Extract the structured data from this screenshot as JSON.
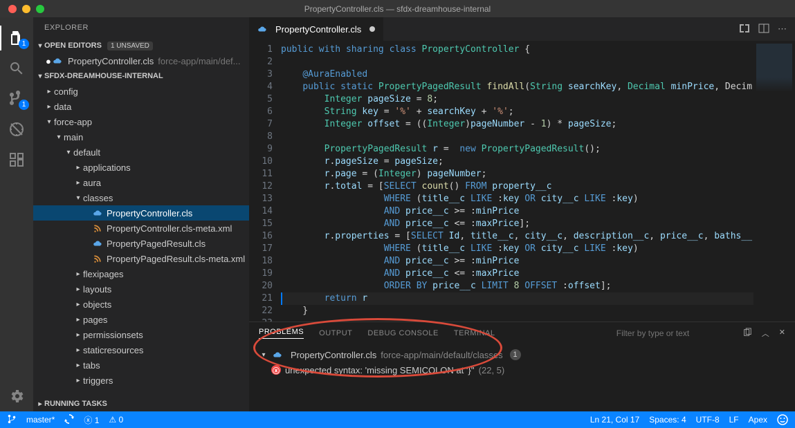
{
  "window": {
    "title": "PropertyController.cls — sfdx-dreamhouse-internal"
  },
  "activity": {
    "badges": {
      "explorer": "1",
      "scm": "1"
    }
  },
  "sidebar": {
    "header": "EXPLORER",
    "openEditors": {
      "title": "OPEN EDITORS",
      "unsaved": "1 UNSAVED"
    },
    "openFile": {
      "name": "PropertyController.cls",
      "path": "force-app/main/def..."
    },
    "projectName": "SFDX-DREAMHOUSE-INTERNAL",
    "tree": [
      {
        "indent": 0,
        "arrow": "▸",
        "label": "config"
      },
      {
        "indent": 0,
        "arrow": "▸",
        "label": "data"
      },
      {
        "indent": 0,
        "arrow": "▾",
        "label": "force-app"
      },
      {
        "indent": 1,
        "arrow": "▾",
        "label": "main"
      },
      {
        "indent": 2,
        "arrow": "▾",
        "label": "default"
      },
      {
        "indent": 3,
        "arrow": "▸",
        "label": "applications"
      },
      {
        "indent": 3,
        "arrow": "▸",
        "label": "aura"
      },
      {
        "indent": 3,
        "arrow": "▾",
        "label": "classes"
      },
      {
        "indent": 4,
        "icon": "cloud",
        "label": "PropertyController.cls",
        "selected": true
      },
      {
        "indent": 4,
        "icon": "feed",
        "label": "PropertyController.cls-meta.xml"
      },
      {
        "indent": 4,
        "icon": "cloud",
        "label": "PropertyPagedResult.cls"
      },
      {
        "indent": 4,
        "icon": "feed",
        "label": "PropertyPagedResult.cls-meta.xml"
      },
      {
        "indent": 3,
        "arrow": "▸",
        "label": "flexipages"
      },
      {
        "indent": 3,
        "arrow": "▸",
        "label": "layouts"
      },
      {
        "indent": 3,
        "arrow": "▸",
        "label": "objects"
      },
      {
        "indent": 3,
        "arrow": "▸",
        "label": "pages"
      },
      {
        "indent": 3,
        "arrow": "▸",
        "label": "permissionsets"
      },
      {
        "indent": 3,
        "arrow": "▸",
        "label": "staticresources"
      },
      {
        "indent": 3,
        "arrow": "▸",
        "label": "tabs"
      },
      {
        "indent": 3,
        "arrow": "▸",
        "label": "triggers"
      }
    ],
    "runningTasks": "RUNNING TASKS"
  },
  "editor": {
    "tabName": "PropertyController.cls",
    "lines": [
      "public with sharing class PropertyController {",
      "",
      "    @AuraEnabled",
      "    public static PropertyPagedResult findAll(String searchKey, Decimal minPrice, Decim",
      "        Integer pageSize = 8;",
      "        String key = '%' + searchKey + '%';",
      "        Integer offset = ((Integer)pageNumber - 1) * pageSize;",
      "",
      "        PropertyPagedResult r =  new PropertyPagedResult();",
      "        r.pageSize = pageSize;",
      "        r.page = (Integer) pageNumber;",
      "        r.total = [SELECT count() FROM property__c",
      "                   WHERE (title__c LIKE :key OR city__c LIKE :key)",
      "                   AND price__c >= :minPrice",
      "                   AND price__c <= :maxPrice];",
      "        r.properties = [SELECT Id, title__c, city__c, description__c, price__c, baths__",
      "                   WHERE (title__c LIKE :key OR city__c LIKE :key)",
      "                   AND price__c >= :minPrice",
      "                   AND price__c <= :maxPrice",
      "                   ORDER BY price__c LIMIT 8 OFFSET :offset];",
      "        return r",
      "    }",
      ""
    ]
  },
  "panel": {
    "tabs": [
      "PROBLEMS",
      "OUTPUT",
      "DEBUG CONSOLE",
      "TERMINAL"
    ],
    "activeTab": 0,
    "filterPlaceholder": "Filter by type or text",
    "problem": {
      "file": "PropertyController.cls",
      "filePath": "force-app/main/default/classes",
      "count": "1",
      "message": "unexpected syntax: 'missing SEMICOLON at '}''",
      "location": "(22, 5)"
    }
  },
  "status": {
    "branch": "master*",
    "sync": "",
    "errors": "1",
    "warnings": "0",
    "lncol": "Ln 21, Col 17",
    "spaces": "Spaces: 4",
    "encoding": "UTF-8",
    "eol": "LF",
    "lang": "Apex"
  }
}
